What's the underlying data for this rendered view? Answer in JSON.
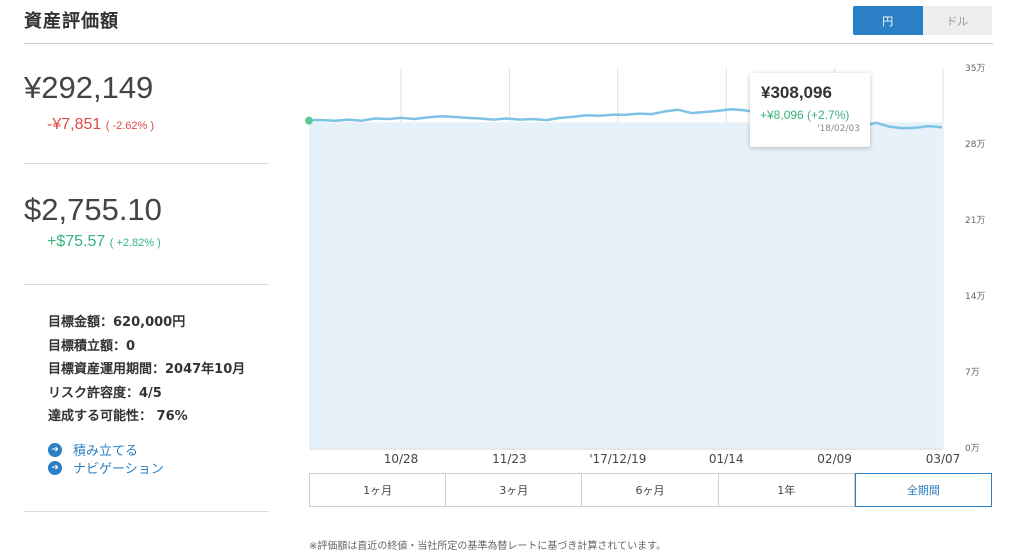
{
  "header": {
    "title": "資産評価額",
    "currency_options": [
      "円",
      "ドル"
    ],
    "currency_selected": "円"
  },
  "summary": {
    "jpy": {
      "value": "¥292,149",
      "change": "-¥7,851",
      "change_pct": "( -2.62% )"
    },
    "usd": {
      "value": "$2,755.10",
      "change": "+$75.57",
      "change_pct": "( +2.82% )"
    }
  },
  "goals": [
    "目標金額：620,000円",
    "目標積立額：0",
    "目標資産運用期間：2047年10月",
    "リスク許容度：4/5",
    "達成する可能性： 76%"
  ],
  "links": [
    {
      "label": "積み立てる",
      "icon": "arrow-right-icon"
    },
    {
      "label": "ナビゲーション",
      "icon": "arrow-right-icon"
    }
  ],
  "tooltip": {
    "value": "¥308,096",
    "change": "+¥8,096 (+2.7%)",
    "date": "'18/02/03"
  },
  "periods": [
    "1ヶ月",
    "3ヶ月",
    "6ヶ月",
    "1年",
    "全期間"
  ],
  "period_selected": "全期間",
  "footnote": "※評価額は直近の終値・当社所定の基準為替レートに基づき計算されています。",
  "colors": {
    "accent": "#2b7fc4",
    "line": "#7ec3e6",
    "area": "#e6f1f9",
    "negative": "#e04848",
    "positive": "#37b37e"
  },
  "chart_data": {
    "type": "area",
    "y_unit": "万",
    "ylim": [
      0,
      350000
    ],
    "y_ticks": [
      0,
      70000,
      140000,
      210000,
      280000,
      350000
    ],
    "y_tick_labels": [
      "0万",
      "7万",
      "14万",
      "21万",
      "28万",
      "35万"
    ],
    "x_tick_labels": [
      "10/28",
      "11/23",
      "'17/12/19",
      "01/14",
      "02/09",
      "03/07"
    ],
    "baseline": 300000,
    "series": [
      {
        "values": [
          302000,
          302000,
          301500,
          302500,
          301500,
          303500,
          303000,
          304000,
          303000,
          304500,
          305500,
          305000,
          304000,
          303500,
          302500,
          303500,
          302500,
          303000,
          302000,
          304000,
          305000,
          306500,
          306000,
          307000,
          307000,
          308000,
          307500,
          310000,
          311500,
          308500,
          309500,
          310500,
          312000,
          311000,
          309000,
          308096,
          303000,
          296000,
          294000,
          296500,
          297000,
          297500,
          297000,
          299500,
          296000,
          294500,
          295000,
          296500,
          295500
        ]
      }
    ],
    "highlight_points": [
      {
        "index": 0,
        "value": 301500
      },
      {
        "index": 35,
        "value": 308096
      }
    ]
  }
}
